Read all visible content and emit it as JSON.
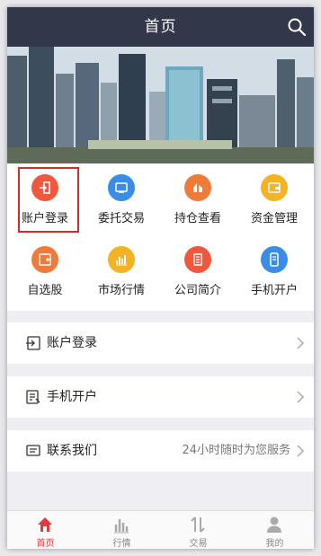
{
  "header": {
    "title": "首页"
  },
  "grid": {
    "items": [
      {
        "label": "账户登录",
        "icon": "login-icon",
        "color": "#f0573d"
      },
      {
        "label": "委托交易",
        "icon": "trade-icon",
        "color": "#3a8de6"
      },
      {
        "label": "持仓查看",
        "icon": "holdings-icon",
        "color": "#f07a3a"
      },
      {
        "label": "资金管理",
        "icon": "wallet-icon",
        "color": "#f4b324"
      },
      {
        "label": "自选股",
        "icon": "watchlist-icon",
        "color": "#f07a3a"
      },
      {
        "label": "市场行情",
        "icon": "market-chart-icon",
        "color": "#f4b324"
      },
      {
        "label": "公司简介",
        "icon": "company-icon",
        "color": "#f0573d"
      },
      {
        "label": "手机开户",
        "icon": "phone-account-icon",
        "color": "#3a8de6"
      }
    ]
  },
  "list": {
    "items": [
      {
        "label": "账户登录",
        "icon": "login-icon",
        "right": ""
      },
      {
        "label": "手机开户",
        "icon": "phone-form-icon",
        "right": ""
      },
      {
        "label": "联系我们",
        "icon": "message-icon",
        "right": "24小时随时为您服务"
      }
    ]
  },
  "tabbar": {
    "items": [
      {
        "label": "首页",
        "icon": "home-icon",
        "active": true
      },
      {
        "label": "行情",
        "icon": "bar-chart-icon",
        "active": false
      },
      {
        "label": "交易",
        "icon": "exchange-icon",
        "active": false
      },
      {
        "label": "我的",
        "icon": "user-icon",
        "active": false
      }
    ]
  },
  "colors": {
    "header": "#323749",
    "accent": "#e23a3a",
    "highlight_box": "#d62b2b"
  }
}
